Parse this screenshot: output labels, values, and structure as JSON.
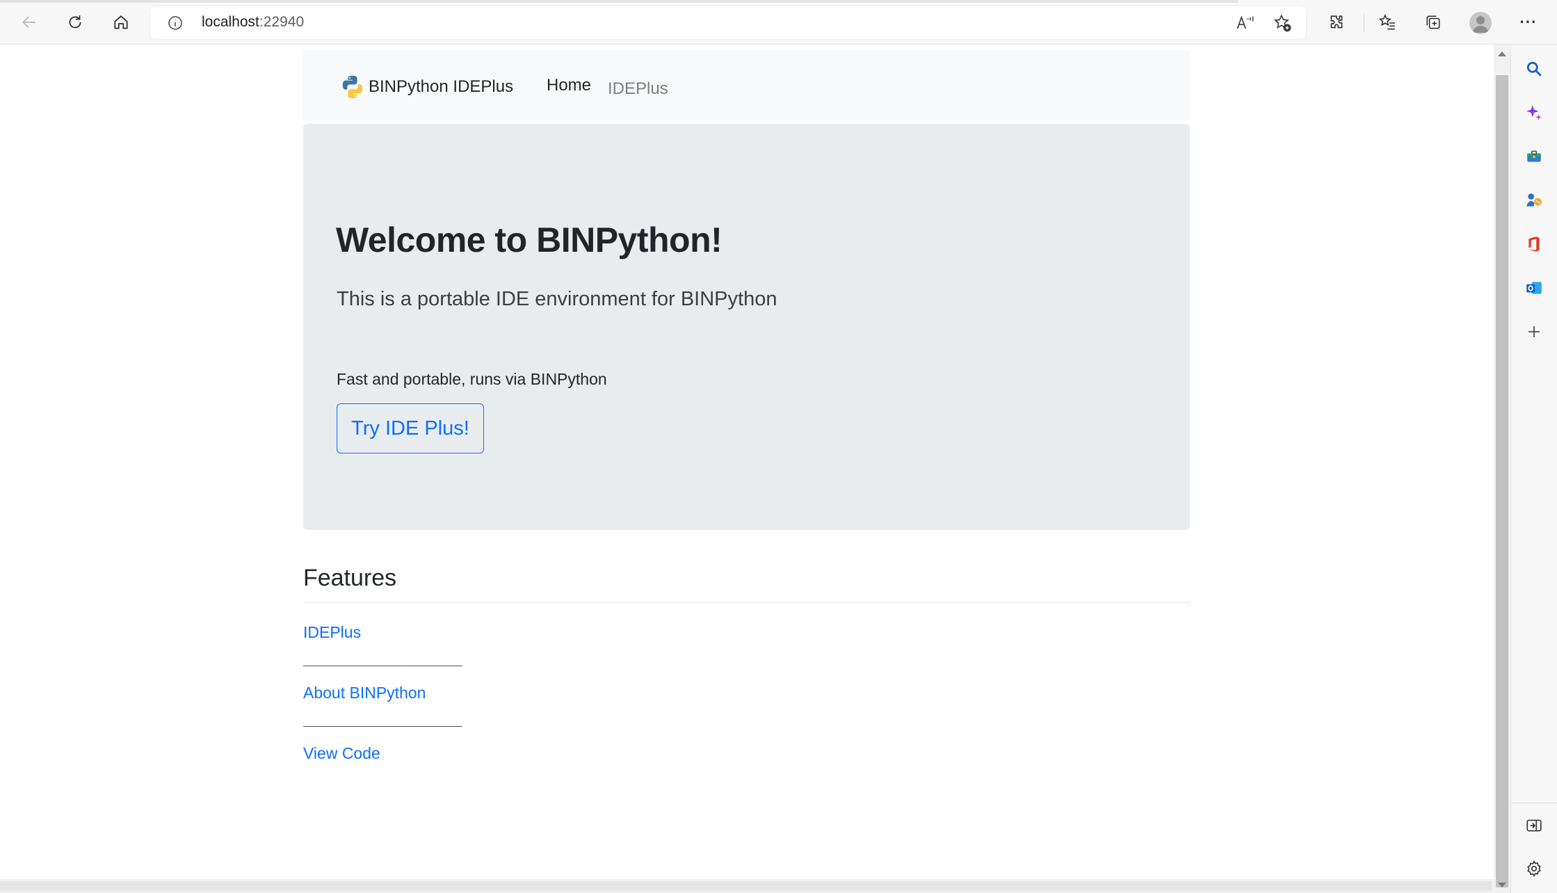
{
  "browser": {
    "url_host": "localhost",
    "url_port": ":22940",
    "back_icon": "arrow-left",
    "refresh_icon": "refresh",
    "home_icon": "home",
    "menu_label": "···"
  },
  "sidebar": {
    "items": [
      "search-icon",
      "copilot-icon",
      "tools-icon",
      "games-icon",
      "office-icon",
      "outlook-icon",
      "add-icon"
    ]
  },
  "navbar": {
    "brand": "BINPython IDEPlus",
    "links": [
      {
        "label": "Home"
      },
      {
        "label": "IDEPlus"
      }
    ]
  },
  "hero": {
    "title": "Welcome to BINPython!",
    "lead": "This is a portable IDE environment for BINPython",
    "text": "Fast and portable, runs via BINPython",
    "button_label": "Try IDE Plus!"
  },
  "features": {
    "title": "Features",
    "links": [
      "IDEPlus",
      "About BINPython",
      "View Code"
    ]
  },
  "colors": {
    "link": "#0d6efd",
    "hero_bg": "#e9ecef",
    "navbar_bg": "#f8f9fa"
  }
}
